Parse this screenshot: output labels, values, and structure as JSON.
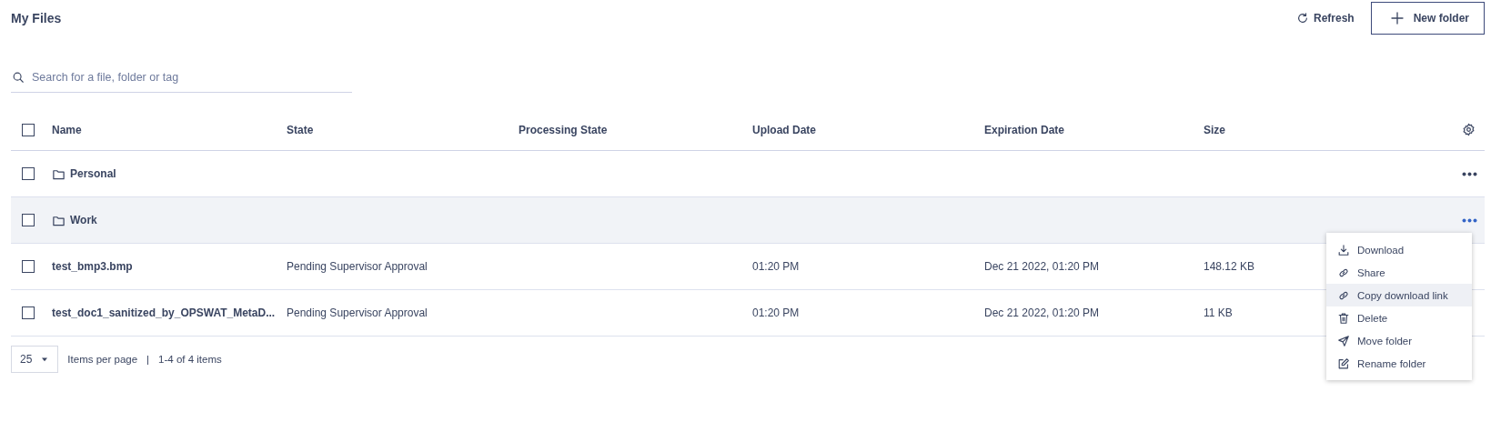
{
  "header": {
    "title": "My Files",
    "refresh": "Refresh",
    "new_folder": "New folder"
  },
  "search": {
    "placeholder": "Search for a file, folder or tag"
  },
  "table": {
    "columns": [
      "Name",
      "State",
      "Processing State",
      "Upload Date",
      "Expiration Date",
      "Size"
    ],
    "select_all": {
      "checked": false
    },
    "rows": [
      {
        "kind": "folder",
        "checked": false,
        "hovered": false,
        "more_button": true,
        "menu_open": false,
        "cells": [
          "Personal",
          "",
          "",
          "",
          "",
          ""
        ]
      },
      {
        "kind": "folder",
        "checked": false,
        "hovered": true,
        "more_button": true,
        "menu_open": true,
        "cells": [
          "Work",
          "",
          "",
          "",
          "",
          ""
        ]
      },
      {
        "kind": "file",
        "checked": false,
        "hovered": false,
        "more_button": false,
        "menu_open": false,
        "cells": [
          "test_bmp3.bmp",
          "Pending Supervisor Approval",
          "",
          "01:20 PM",
          "Dec 21 2022, 01:20 PM",
          "148.12 KB"
        ]
      },
      {
        "kind": "file",
        "checked": false,
        "hovered": false,
        "more_button": false,
        "menu_open": false,
        "cells": [
          "test_doc1_sanitized_by_OPSWAT_MetaD...",
          "Pending Supervisor Approval",
          "",
          "01:20 PM",
          "Dec 21 2022, 01:20 PM",
          "11 KB"
        ]
      }
    ]
  },
  "pagination": {
    "page_size": "25",
    "per_page_label": "Items per page",
    "separator": "|",
    "range": "1-4 of 4 items"
  },
  "context_menu": {
    "items": [
      {
        "kind": "download",
        "label": "Download",
        "highlighted": false
      },
      {
        "kind": "link",
        "label": "Share",
        "highlighted": false
      },
      {
        "kind": "link",
        "label": "Copy download link",
        "highlighted": true
      },
      {
        "kind": "delete",
        "label": "Delete",
        "highlighted": false
      },
      {
        "kind": "move",
        "label": "Move folder",
        "highlighted": false
      },
      {
        "kind": "rename",
        "label": "Rename folder",
        "highlighted": false
      }
    ]
  }
}
